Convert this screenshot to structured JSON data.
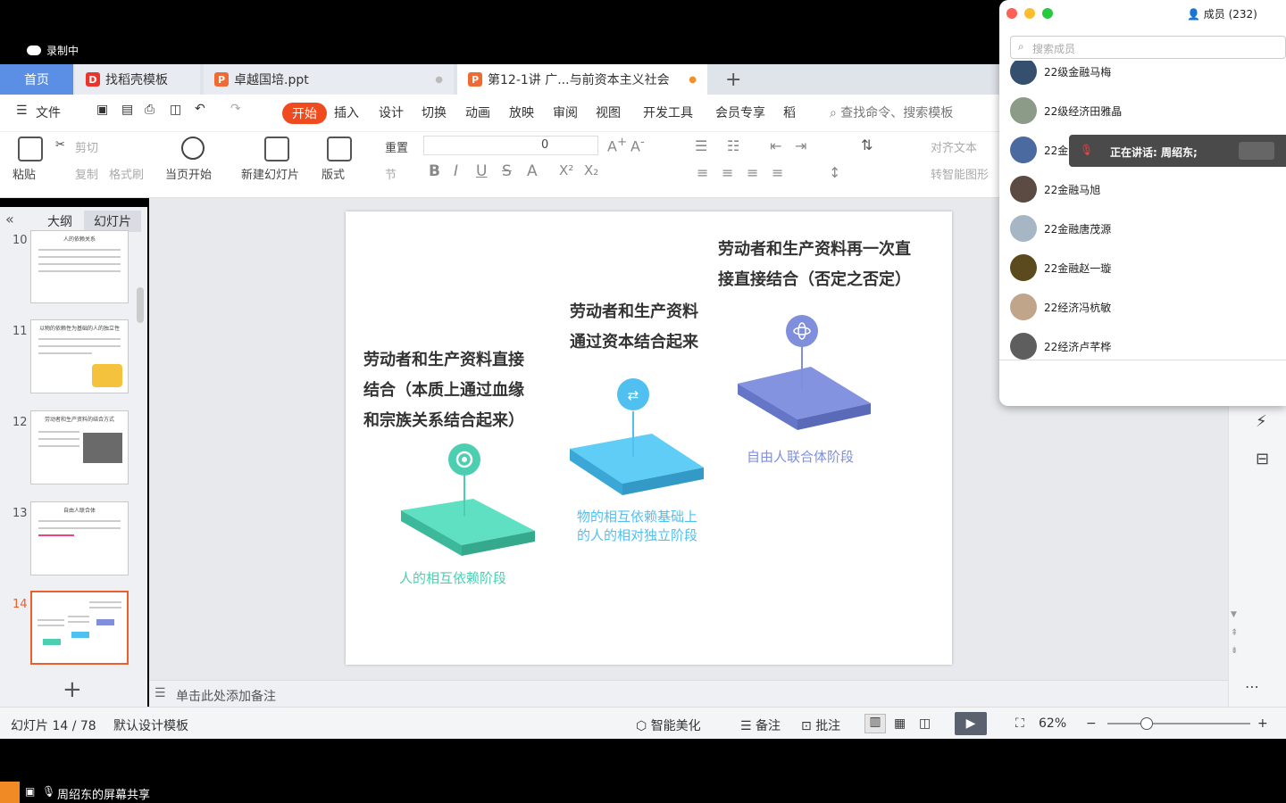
{
  "recording": {
    "label": "录制中"
  },
  "tabs": {
    "home": "首页",
    "find_template": "找稻壳模板",
    "doc1": "卓越国培.ppt",
    "doc2": "第12-1讲 广...与前资本主义社会"
  },
  "menu": {
    "file": "文件",
    "start": "开始",
    "insert": "插入",
    "design": "设计",
    "transition": "切换",
    "animation": "动画",
    "slideshow": "放映",
    "review": "审阅",
    "view": "视图",
    "devtools": "开发工具",
    "member": "会员专享",
    "daoke": "稻",
    "search": "查找命令、搜索模板"
  },
  "ribbon": {
    "paste": "粘贴",
    "cut": "剪切",
    "copy": "复制",
    "format_painter": "格式刷",
    "from_current": "当页开始",
    "new_slide": "新建幻灯片",
    "layout": "版式",
    "reset": "重置",
    "section": "节",
    "font_size": "0",
    "align_text": "对齐文本",
    "smart_art": "转智能图形"
  },
  "left_panel": {
    "outline_tab": "大纲",
    "slides_tab": "幻灯片",
    "thumbs": [
      {
        "num": "10",
        "title": "人的依赖关系"
      },
      {
        "num": "11",
        "title": "以物的依赖性为基础的人的独立性"
      },
      {
        "num": "12",
        "title": "劳动者和生产资料的结合方式"
      },
      {
        "num": "13",
        "title": "自由人联合体"
      },
      {
        "num": "14",
        "title": ""
      }
    ]
  },
  "slide": {
    "text_left": [
      "劳动者和生产资料直接",
      "结合（本质上通过血缘",
      "和宗族关系结合起来）"
    ],
    "text_mid": [
      "劳动者和生产资料",
      "通过资本结合起来"
    ],
    "text_right": [
      "劳动者和生产资料再一次直",
      "接直接结合（否定之否定）"
    ],
    "caption_1": "人的相互依赖阶段",
    "caption_2": [
      "物的相互依赖基础上",
      "的人的相对独立阶段"
    ],
    "caption_3": "自由人联合体阶段",
    "colors": {
      "green": "#4ccfb1",
      "blue": "#4fc0ef",
      "purple": "#7f8fdc"
    }
  },
  "notes": {
    "placeholder": "单击此处添加备注"
  },
  "status": {
    "slide_count": "幻灯片 14 / 78",
    "template": "默认设计模板",
    "beautify": "智能美化",
    "notes": "备注",
    "comment": "批注",
    "zoom": "62%"
  },
  "share": {
    "label": "周绍东的屏幕共享"
  },
  "members": {
    "title": "成员 (232)",
    "search_placeholder": "搜索成员",
    "speaking": "正在讲话: 周绍东;",
    "list": [
      "22级金融马梅",
      "22级经济田雅晶",
      "22金",
      "22金融马旭",
      "22金融唐茂源",
      "22金融赵一璇",
      "22经济冯杭敏",
      "22经济卢芊桦"
    ]
  }
}
